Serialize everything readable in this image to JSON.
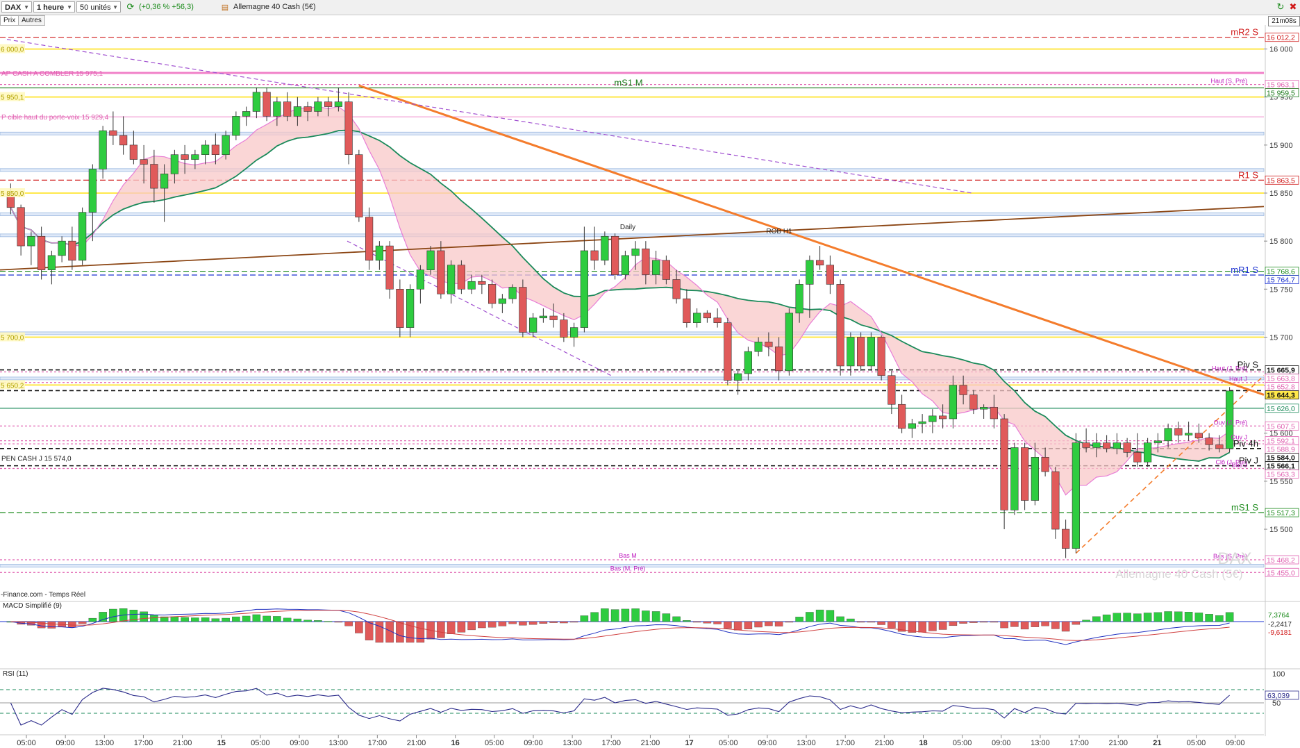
{
  "toolbar": {
    "symbol": "DAX",
    "timeframe": "1 heure",
    "units": "50 unités",
    "change": "(+0,36 % +56,3)",
    "instrument": "Allemagne 40 Cash (5€)",
    "countdown": "21m08s"
  },
  "tabs": [
    "Prix",
    "Autres"
  ],
  "colors": {
    "up": "#2ecc40",
    "down": "#e05a5a",
    "ma_green": "#1a8a5a",
    "ma_pink": "#e87dd6",
    "band": "#f8c8c8",
    "trend_orange": "#f47c2c",
    "trend_brown": "#8b4513",
    "yellow": "#ffe84a"
  },
  "chart_data": {
    "type": "candlestick",
    "watermark": {
      "symbol": "DAX",
      "name": "Allemagne 40 Cash (5€)"
    },
    "source": "-Finance.com - Temps Réel",
    "price_axis": {
      "range": [
        15440,
        16025
      ],
      "ticks": [
        15500,
        15550,
        15600,
        15650,
        15700,
        15750,
        15800,
        15850,
        15900,
        15950,
        16000
      ]
    },
    "price_axis_labels": [
      "15 500",
      "15 550",
      "15 600",
      "15 650",
      "15 700",
      "15 750",
      "15 800",
      "15 850",
      "15 900",
      "15 950",
      "16 000"
    ],
    "time_axis": [
      "05:00",
      "09:00",
      "13:00",
      "17:00",
      "21:00",
      "15",
      "05:00",
      "09:00",
      "13:00",
      "17:00",
      "21:00",
      "16",
      "05:00",
      "09:00",
      "13:00",
      "17:00",
      "21:00",
      "17",
      "05:00",
      "09:00",
      "13:00",
      "17:00",
      "21:00",
      "18",
      "05:00",
      "09:00",
      "13:00",
      "17:00",
      "21:00",
      "21",
      "05:00",
      "09:00"
    ],
    "levels": [
      {
        "label": "mR2 S",
        "value": "16 012,2",
        "price": 16012.2,
        "color": "#d01818"
      },
      {
        "label": "",
        "value": "15 963,1",
        "price": 15963.1,
        "color": "#e060b0"
      },
      {
        "label": "mS1 M",
        "value": "15 959,5",
        "price": 15959.5,
        "color": "#1a7a1a"
      },
      {
        "label": "R1 S",
        "value": "15 863,5",
        "price": 15863.5,
        "color": "#d01818"
      },
      {
        "label": "",
        "value": "15 768,6",
        "price": 15768.6,
        "color": "#1a8a1a"
      },
      {
        "label": "mR1 S",
        "value": "15 764,7",
        "price": 15764.7,
        "color": "#1a30d0"
      },
      {
        "label": "Piv S",
        "value": "15 665,9",
        "price": 15665.9,
        "color": "#111111"
      },
      {
        "label": "",
        "value": "15 663,8",
        "price": 15663.8,
        "color": "#e060b0"
      },
      {
        "label": "",
        "value": "15 652,8",
        "price": 15652.8,
        "color": "#e060b0"
      },
      {
        "label": "",
        "value": "15 644,3",
        "price": 15644.3,
        "color": "#111111"
      },
      {
        "label": "",
        "value": "15 626,0",
        "price": 15626.0,
        "color": "#1a8a5a"
      },
      {
        "label": "",
        "value": "15 607,5",
        "price": 15607.5,
        "color": "#e060b0"
      },
      {
        "label": "",
        "value": "15 592,1",
        "price": 15592.1,
        "color": "#e060b0"
      },
      {
        "label": "",
        "value": "15 588,9",
        "price": 15588.9,
        "color": "#e060b0"
      },
      {
        "label": "Piv 4h",
        "value": "15 584,0",
        "price": 15584.0,
        "color": "#111111"
      },
      {
        "label": "Piv J",
        "value": "15 566,1",
        "price": 15566.1,
        "color": "#111111"
      },
      {
        "label": "",
        "value": "15 563,3",
        "price": 15563.3,
        "color": "#e060b0"
      },
      {
        "label": "mS1 S",
        "value": "15 517,3",
        "price": 15517.3,
        "color": "#1a8a1a"
      },
      {
        "label": "",
        "value": "15 468,2",
        "price": 15468.2,
        "color": "#e060b0"
      },
      {
        "label": "",
        "value": "15 455,0",
        "price": 15455.0,
        "color": "#e060b0"
      }
    ],
    "annotations": [
      {
        "text": "AP CASH A COMBLER 15 975,1",
        "price": 15975.1,
        "color": "#e060b0"
      },
      {
        "text": "P cible haut du porte-voix 15 929,4",
        "price": 15929.4,
        "color": "#e060b0"
      },
      {
        "text": "PEN CASH J 15 574,0",
        "price": 15574.0,
        "color": "#222222"
      },
      {
        "text": "Haut (S, Pré)",
        "price": 15963.1,
        "color": "#c020c0"
      },
      {
        "text": "Haut (J, Pré)",
        "price": 15663.8,
        "color": "#c020c0"
      },
      {
        "text": "Haut J",
        "price": 15652.8,
        "color": "#c020c0"
      },
      {
        "text": "Ouv (J, Pré)",
        "price": 15607.5,
        "color": "#c020c0"
      },
      {
        "text": "Ouv J",
        "price": 15592.1,
        "color": "#c020c0"
      },
      {
        "text": "Clô (J, Pré)",
        "price": 15566.1,
        "color": "#c020c0"
      },
      {
        "text": "Bas J",
        "price": 15563.3,
        "color": "#c020c0"
      },
      {
        "text": "Bas M",
        "price": 15468.2,
        "color": "#c020c0"
      },
      {
        "text": "Bas (S, Pré)",
        "price": 15468.2,
        "color": "#c020c0"
      },
      {
        "text": "Bas (M, Pré)",
        "price": 15455.0,
        "color": "#c020c0"
      },
      {
        "text": "Daily",
        "price": 15805,
        "color": "#222222"
      },
      {
        "text": "ROB H1",
        "price": 15800,
        "color": "#222222"
      }
    ],
    "left_labels": [
      {
        "text": "6 000,0",
        "price": 16000.0
      },
      {
        "text": "5 950,1",
        "price": 15950.1
      },
      {
        "text": "5 850,0",
        "price": 15850.0
      },
      {
        "text": "5 700,0",
        "price": 15700.0
      },
      {
        "text": "5 650,2",
        "price": 15650.2
      }
    ],
    "series": [
      {
        "name": "",
        "type": "ohlc",
        "values": [
          [
            15850,
            15860,
            15828,
            15835
          ],
          [
            15835,
            15838,
            15785,
            15795
          ],
          [
            15795,
            15810,
            15775,
            15805
          ],
          [
            15805,
            15815,
            15760,
            15770
          ],
          [
            15770,
            15790,
            15755,
            15785
          ],
          [
            15785,
            15805,
            15778,
            15800
          ],
          [
            15800,
            15815,
            15770,
            15780
          ],
          [
            15780,
            15835,
            15775,
            15830
          ],
          [
            15830,
            15880,
            15800,
            15875
          ],
          [
            15875,
            15920,
            15865,
            15915
          ],
          [
            15915,
            15935,
            15900,
            15910
          ],
          [
            15910,
            15930,
            15890,
            15900
          ],
          [
            15900,
            15915,
            15880,
            15885
          ],
          [
            15885,
            15900,
            15860,
            15880
          ],
          [
            15880,
            15895,
            15840,
            15855
          ],
          [
            15855,
            15880,
            15820,
            15870
          ],
          [
            15870,
            15895,
            15860,
            15890
          ],
          [
            15890,
            15900,
            15870,
            15885
          ],
          [
            15885,
            15895,
            15875,
            15890
          ],
          [
            15890,
            15905,
            15880,
            15900
          ],
          [
            15900,
            15912,
            15880,
            15890
          ],
          [
            15890,
            15915,
            15885,
            15910
          ],
          [
            15910,
            15935,
            15905,
            15930
          ],
          [
            15930,
            15940,
            15920,
            15935
          ],
          [
            15935,
            15960,
            15928,
            15955
          ],
          [
            15955,
            15960,
            15925,
            15930
          ],
          [
            15930,
            15950,
            15920,
            15945
          ],
          [
            15945,
            15955,
            15925,
            15930
          ],
          [
            15930,
            15950,
            15920,
            15940
          ],
          [
            15940,
            15945,
            15925,
            15935
          ],
          [
            15935,
            15950,
            15930,
            15945
          ],
          [
            15945,
            15950,
            15930,
            15940
          ],
          [
            15940,
            15960,
            15935,
            15945
          ],
          [
            15945,
            15955,
            15880,
            15890
          ],
          [
            15890,
            15895,
            15820,
            15825
          ],
          [
            15825,
            15835,
            15770,
            15780
          ],
          [
            15780,
            15800,
            15770,
            15795
          ],
          [
            15795,
            15800,
            15740,
            15750
          ],
          [
            15750,
            15760,
            15700,
            15710
          ],
          [
            15710,
            15755,
            15700,
            15750
          ],
          [
            15750,
            15775,
            15735,
            15770
          ],
          [
            15770,
            15795,
            15765,
            15790
          ],
          [
            15790,
            15800,
            15740,
            15745
          ],
          [
            15745,
            15780,
            15735,
            15775
          ],
          [
            15775,
            15780,
            15745,
            15750
          ],
          [
            15750,
            15765,
            15745,
            15758
          ],
          [
            15758,
            15765,
            15745,
            15755
          ],
          [
            15755,
            15760,
            15730,
            15735
          ],
          [
            15735,
            15745,
            15725,
            15740
          ],
          [
            15740,
            15755,
            15735,
            15752
          ],
          [
            15752,
            15760,
            15700,
            15705
          ],
          [
            15705,
            15725,
            15700,
            15720
          ],
          [
            15720,
            15730,
            15715,
            15722
          ],
          [
            15722,
            15735,
            15710,
            15718
          ],
          [
            15718,
            15725,
            15695,
            15700
          ],
          [
            15700,
            15715,
            15690,
            15710
          ],
          [
            15710,
            15815,
            15705,
            15790
          ],
          [
            15790,
            15815,
            15770,
            15780
          ],
          [
            15780,
            15810,
            15775,
            15805
          ],
          [
            15805,
            15808,
            15760,
            15765
          ],
          [
            15765,
            15790,
            15760,
            15785
          ],
          [
            15785,
            15800,
            15770,
            15792
          ],
          [
            15792,
            15800,
            15755,
            15765
          ],
          [
            15765,
            15790,
            15755,
            15780
          ],
          [
            15780,
            15785,
            15755,
            15760
          ],
          [
            15760,
            15770,
            15735,
            15740
          ],
          [
            15740,
            15750,
            15710,
            15715
          ],
          [
            15715,
            15730,
            15710,
            15725
          ],
          [
            15725,
            15728,
            15715,
            15720
          ],
          [
            15720,
            15730,
            15710,
            15715
          ],
          [
            15715,
            15720,
            15650,
            15655
          ],
          [
            15655,
            15665,
            15640,
            15662
          ],
          [
            15662,
            15690,
            15655,
            15685
          ],
          [
            15685,
            15700,
            15680,
            15695
          ],
          [
            15695,
            15705,
            15680,
            15690
          ],
          [
            15690,
            15700,
            15655,
            15665
          ],
          [
            15665,
            15730,
            15660,
            15725
          ],
          [
            15725,
            15760,
            15715,
            15755
          ],
          [
            15755,
            15785,
            15720,
            15780
          ],
          [
            15780,
            15795,
            15770,
            15775
          ],
          [
            15775,
            15785,
            15745,
            15755
          ],
          [
            15755,
            15760,
            15660,
            15670
          ],
          [
            15670,
            15705,
            15660,
            15700
          ],
          [
            15700,
            15705,
            15665,
            15670
          ],
          [
            15670,
            15705,
            15665,
            15700
          ],
          [
            15700,
            15702,
            15655,
            15660
          ],
          [
            15660,
            15665,
            15620,
            15630
          ],
          [
            15630,
            15640,
            15600,
            15605
          ],
          [
            15605,
            15615,
            15595,
            15610
          ],
          [
            15610,
            15620,
            15600,
            15612
          ],
          [
            15612,
            15625,
            15600,
            15618
          ],
          [
            15618,
            15630,
            15605,
            15615
          ],
          [
            15615,
            15660,
            15605,
            15650
          ],
          [
            15650,
            15660,
            15630,
            15640
          ],
          [
            15640,
            15645,
            15620,
            15625
          ],
          [
            15625,
            15630,
            15615,
            15627
          ],
          [
            15627,
            15640,
            15605,
            15615
          ],
          [
            15615,
            15620,
            15500,
            15520
          ],
          [
            15520,
            15590,
            15515,
            15585
          ],
          [
            15585,
            15590,
            15520,
            15530
          ],
          [
            15530,
            15590,
            15525,
            15575
          ],
          [
            15575,
            15585,
            15555,
            15560
          ],
          [
            15560,
            15565,
            15490,
            15500
          ],
          [
            15500,
            15510,
            15470,
            15480
          ],
          [
            15480,
            15600,
            15475,
            15590
          ],
          [
            15590,
            15605,
            15580,
            15585
          ],
          [
            15585,
            15600,
            15575,
            15590
          ],
          [
            15590,
            15598,
            15580,
            15584
          ],
          [
            15584,
            15600,
            15578,
            15590
          ],
          [
            15590,
            15595,
            15575,
            15580
          ],
          [
            15580,
            15600,
            15565,
            15570
          ],
          [
            15570,
            15595,
            15565,
            15590
          ],
          [
            15590,
            15600,
            15580,
            15592
          ],
          [
            15592,
            15610,
            15585,
            15605
          ],
          [
            15605,
            15612,
            15590,
            15598
          ],
          [
            15598,
            15612,
            15592,
            15600
          ],
          [
            15600,
            15610,
            15590,
            15595
          ],
          [
            15595,
            15600,
            15582,
            15588
          ],
          [
            15588,
            15598,
            15580,
            15584
          ],
          [
            15584,
            15648,
            15580,
            15644
          ]
        ]
      }
    ]
  },
  "macd": {
    "label": "MACD Simplifié (9)",
    "values": [
      "7,3764",
      "-2,2417",
      "-9,6181"
    ]
  },
  "rsi": {
    "label": "RSI (11)",
    "value": "63,039",
    "axis": [
      "100",
      "50"
    ]
  }
}
